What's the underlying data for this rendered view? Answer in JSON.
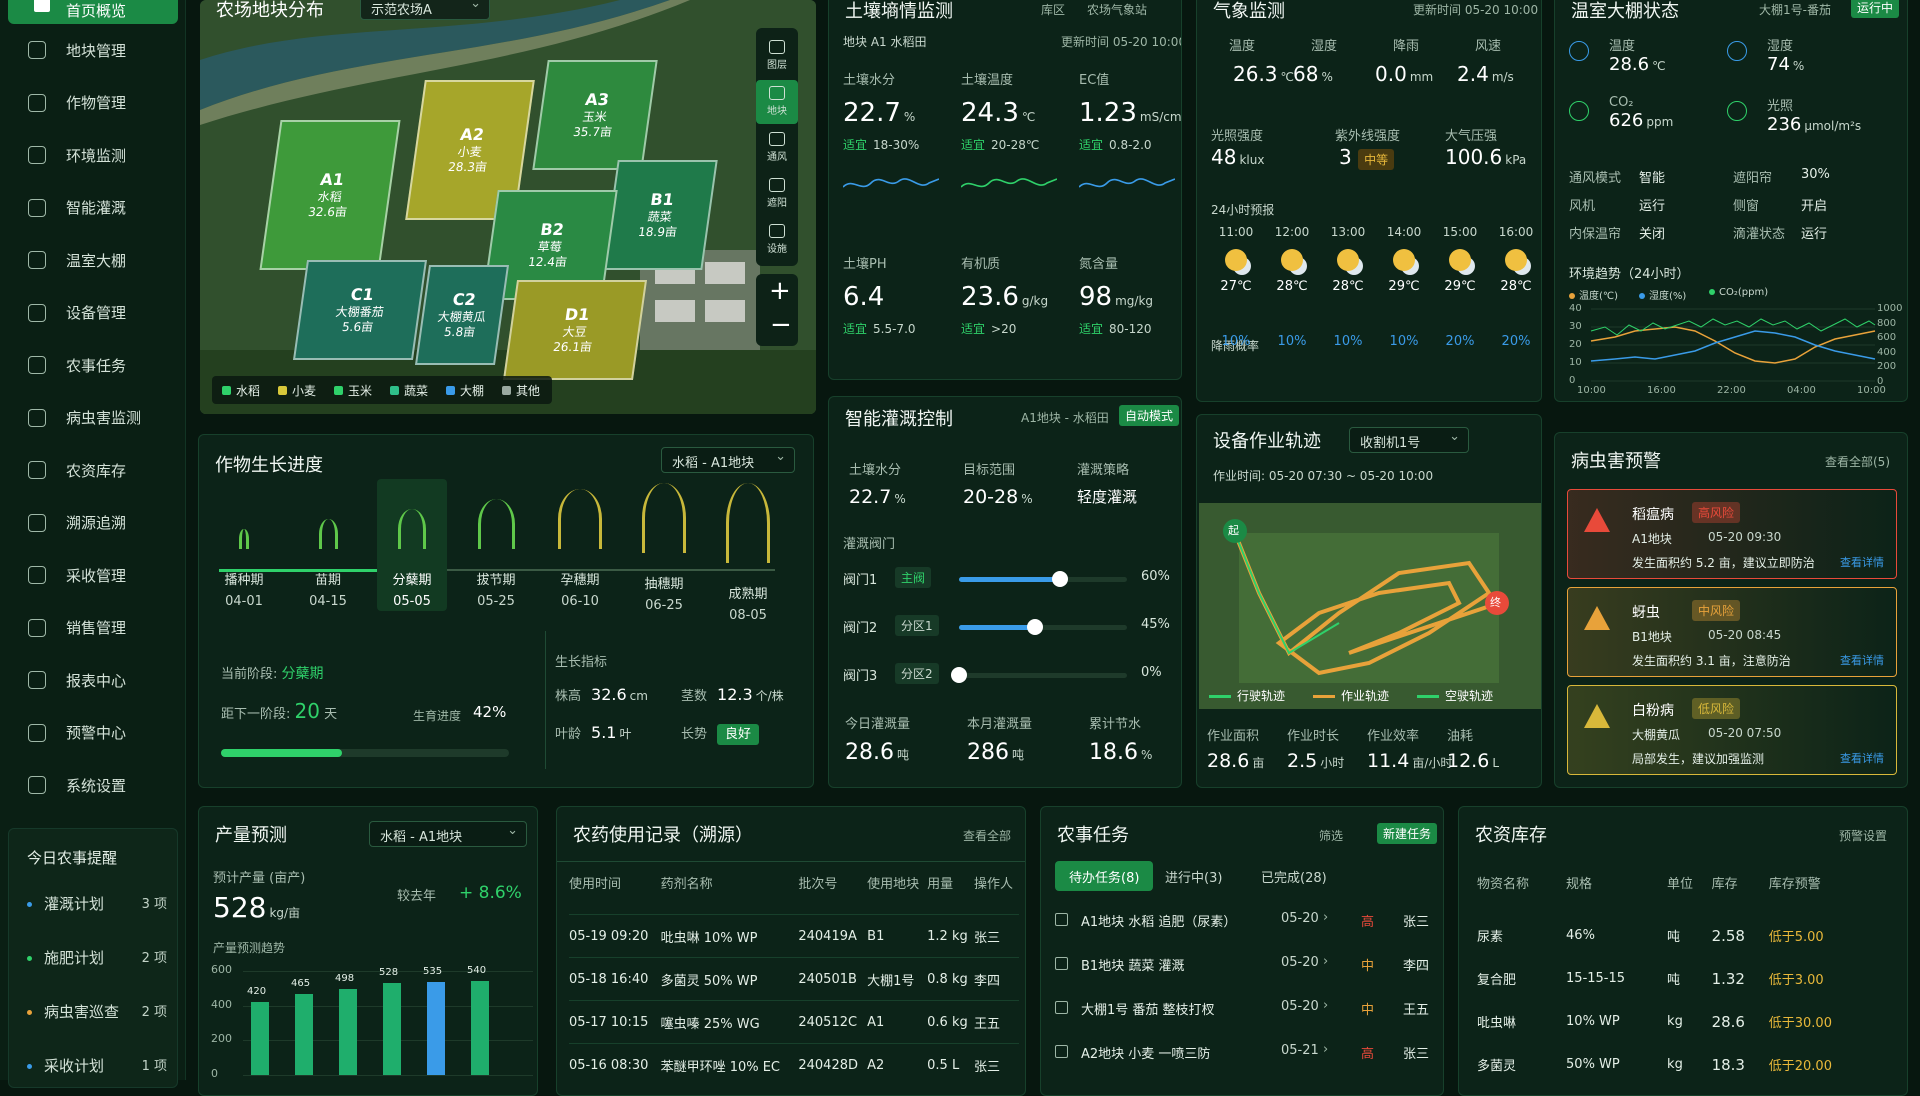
{
  "nav": {
    "top": "首页概览",
    "items": [
      "地块管理",
      "作物管理",
      "环境监测",
      "智能灌溉",
      "温室大棚",
      "设备管理",
      "农事任务",
      "病虫害监测",
      "农资库存",
      "溯源追溯",
      "采收管理",
      "销售管理",
      "报表中心",
      "预警中心",
      "系统设置"
    ]
  },
  "remind": {
    "title": "今日农事提醒",
    "items": [
      {
        "label": "灌溉计划",
        "count": "3 项",
        "color": "#3a9be8"
      },
      {
        "label": "施肥计划",
        "count": "2 项",
        "color": "#2fd16a"
      },
      {
        "label": "病虫害巡查",
        "count": "2 项",
        "color": "#e8a23a"
      },
      {
        "label": "采收计划",
        "count": "1 项",
        "color": "#3a9be8"
      }
    ]
  },
  "map": {
    "title": "农场地块分布",
    "farm": "示范农场A",
    "tools": [
      "图层",
      "地块",
      "通风",
      "遮阳",
      "设施"
    ],
    "zoom_in": "+",
    "zoom_out": "−",
    "fields": [
      {
        "id": "A1",
        "crop": "水稻",
        "area": "32.6亩",
        "color": "#3e9a3a"
      },
      {
        "id": "A2",
        "crop": "小麦",
        "area": "28.3亩",
        "color": "#a6a62a"
      },
      {
        "id": "A3",
        "crop": "玉米",
        "area": "35.7亩",
        "color": "#2e8a3e"
      },
      {
        "id": "B1",
        "crop": "蔬菜",
        "area": "18.9亩",
        "color": "#1f7a4a"
      },
      {
        "id": "B2",
        "crop": "草莓",
        "area": "12.4亩",
        "color": "#2a8a44"
      },
      {
        "id": "C1",
        "crop": "大棚番茄",
        "area": "5.6亩",
        "color": "#1e6e5a"
      },
      {
        "id": "C2",
        "crop": "大棚黄瓜",
        "area": "5.8亩",
        "color": "#1e6e5a"
      },
      {
        "id": "D1",
        "crop": "大豆",
        "area": "26.1亩",
        "color": "#9a9a26"
      }
    ],
    "legend": [
      {
        "label": "水稻",
        "color": "#2fd16a"
      },
      {
        "label": "小麦",
        "color": "#d8c83a"
      },
      {
        "label": "玉米",
        "color": "#2fd16a"
      },
      {
        "label": "蔬菜",
        "color": "#2fbf8a"
      },
      {
        "label": "大棚",
        "color": "#3a9be8"
      },
      {
        "label": "其他",
        "color": "#9aa9a0"
      }
    ]
  },
  "soil": {
    "title": "土壤墒情监测",
    "tab1": "库区",
    "tab2": "农场气象站",
    "plot": "地块 A1 水稻田",
    "updated": "更新时间 05-20 10:00",
    "metrics": [
      {
        "label": "土壤水分",
        "value": "22.7",
        "unit": "%",
        "tag": "适宜",
        "range": "18-30%"
      },
      {
        "label": "土壤温度",
        "value": "24.3",
        "unit": "℃",
        "tag": "适宜",
        "range": "20-28℃"
      },
      {
        "label": "EC值",
        "value": "1.23",
        "unit": "mS/cm",
        "tag": "适宜",
        "range": "0.8-2.0"
      },
      {
        "label": "土壤PH",
        "value": "6.4",
        "unit": "",
        "tag": "适宜",
        "range": "5.5-7.0"
      },
      {
        "label": "有机质",
        "value": "23.6",
        "unit": "g/kg",
        "tag": "适宜",
        "range": ">20"
      },
      {
        "label": "氮含量",
        "value": "98",
        "unit": "mg/kg",
        "tag": "适宜",
        "range": "80-120"
      }
    ]
  },
  "weather": {
    "title": "气象监测",
    "updated": "更新时间 05-20 10:00",
    "now": [
      {
        "label": "温度",
        "value": "26.3",
        "unit": "℃"
      },
      {
        "label": "湿度",
        "value": "68",
        "unit": "%"
      },
      {
        "label": "降雨",
        "value": "0.0",
        "unit": "mm"
      },
      {
        "label": "风速",
        "value": "2.4",
        "unit": "m/s"
      }
    ],
    "light": {
      "label": "光照强度",
      "value": "48",
      "unit": "klux"
    },
    "uv": {
      "label": "紫外线强度",
      "value": "3",
      "tag": "中等"
    },
    "pressure": {
      "label": "大气压强",
      "value": "100.6",
      "unit": "kPa"
    },
    "forecast_title": "24小时预报",
    "rain_label": "降雨概率",
    "forecast": [
      {
        "time": "11:00",
        "temp": "27℃",
        "rain": "10%"
      },
      {
        "time": "12:00",
        "temp": "28℃",
        "rain": "10%"
      },
      {
        "time": "13:00",
        "temp": "28℃",
        "rain": "10%"
      },
      {
        "time": "14:00",
        "temp": "29℃",
        "rain": "10%"
      },
      {
        "time": "15:00",
        "temp": "29℃",
        "rain": "20%"
      },
      {
        "time": "16:00",
        "temp": "28℃",
        "rain": "20%"
      }
    ]
  },
  "greenhouse": {
    "title": "温室大棚状态",
    "select": "大棚1号-番茄",
    "status": "运行中",
    "metrics": [
      {
        "label": "温度",
        "value": "28.6",
        "unit": "℃"
      },
      {
        "label": "湿度",
        "value": "74",
        "unit": "%"
      },
      {
        "label": "CO₂",
        "value": "626",
        "unit": "ppm"
      },
      {
        "label": "光照",
        "value": "236",
        "unit": "μmol/m²s"
      }
    ],
    "states": [
      [
        "通风模式",
        "智能",
        "遮阳帘",
        "30%"
      ],
      [
        "风机",
        "运行",
        "侧窗",
        "开启"
      ],
      [
        "内保温帘",
        "关闭",
        "滴灌状态",
        "运行"
      ]
    ],
    "trend_title": "环境趋势（24小时）",
    "legend": [
      "温度(℃)",
      "湿度(%)",
      "CO₂(ppm)"
    ],
    "y_left": [
      "40",
      "30",
      "20",
      "10",
      "0"
    ],
    "y_right": [
      "1000",
      "800",
      "600",
      "400",
      "200",
      "0"
    ],
    "x": [
      "10:00",
      "16:00",
      "22:00",
      "04:00",
      "10:00"
    ]
  },
  "growth": {
    "title": "作物生长进度",
    "select": "水稻 - A1地块",
    "stages": [
      {
        "name": "播种期",
        "date": "04-01"
      },
      {
        "name": "苗期",
        "date": "04-15"
      },
      {
        "name": "分蘖期",
        "date": "05-05"
      },
      {
        "name": "拔节期",
        "date": "05-25"
      },
      {
        "name": "孕穗期",
        "date": "06-10"
      },
      {
        "name": "抽穗期",
        "date": "06-25"
      },
      {
        "name": "成熟期",
        "date": "08-05"
      }
    ],
    "current_label": "当前阶段:",
    "current": "分蘖期",
    "next_label": "距下一阶段:",
    "next_days": "20",
    "next_unit": "天",
    "progress_label": "生育进度",
    "progress": "42%",
    "progress_value": 42,
    "indicator_title": "生长指标",
    "indicators": [
      {
        "label": "株高",
        "value": "32.6",
        "unit": "cm"
      },
      {
        "label": "茎数",
        "value": "12.3",
        "unit": "个/株"
      },
      {
        "label": "叶龄",
        "value": "5.1",
        "unit": "叶"
      },
      {
        "label": "长势",
        "value": "良好",
        "unit": ""
      }
    ]
  },
  "irrigation": {
    "title": "智能灌溉控制",
    "plot": "A1地块 - 水稻田",
    "mode": "自动模式",
    "top": [
      {
        "label": "土壤水分",
        "value": "22.7",
        "unit": "%"
      },
      {
        "label": "目标范围",
        "value": "20-28",
        "unit": "%"
      },
      {
        "label": "灌溉策略",
        "value": "轻度灌溉",
        "unit": ""
      }
    ],
    "valve_title": "灌溉阀门",
    "valves": [
      {
        "name": "阀门1",
        "zone": "主阀",
        "pct": "60%",
        "value": 60
      },
      {
        "name": "阀门2",
        "zone": "分区1",
        "pct": "45%",
        "value": 45
      },
      {
        "name": "阀门3",
        "zone": "分区2",
        "pct": "0%",
        "value": 0
      }
    ],
    "bottom": [
      {
        "label": "今日灌溉量",
        "value": "28.6",
        "unit": "吨"
      },
      {
        "label": "本月灌溉量",
        "value": "286",
        "unit": "吨"
      },
      {
        "label": "累计节水",
        "value": "18.6",
        "unit": "%"
      }
    ]
  },
  "track": {
    "title": "设备作业轨迹",
    "select": "收割机1号",
    "time": "作业时间: 05-20 07:30 ~ 05-20 10:00",
    "start": "起",
    "end": "终",
    "legend": [
      "行驶轨迹",
      "作业轨迹",
      "空驶轨迹"
    ],
    "stats": [
      {
        "label": "作业面积",
        "value": "28.6",
        "unit": "亩"
      },
      {
        "label": "作业时长",
        "value": "2.5",
        "unit": "小时"
      },
      {
        "label": "作业效率",
        "value": "11.4",
        "unit": "亩/小时"
      },
      {
        "label": "油耗",
        "value": "12.6",
        "unit": "L"
      }
    ]
  },
  "pest": {
    "title": "病虫害预警",
    "all": "查看全部(5)",
    "detail": "查看详情",
    "items": [
      {
        "name": "稻瘟病",
        "level": "高风险",
        "plot": "A1地块",
        "time": "05-20 09:30",
        "desc": "发生面积约 5.2 亩，建议立即防治",
        "color": "#e84a3a"
      },
      {
        "name": "蚜虫",
        "level": "中风险",
        "plot": "B1地块",
        "time": "05-20 08:45",
        "desc": "发生面积约 3.1 亩，注意防治",
        "color": "#e8a23a"
      },
      {
        "name": "白粉病",
        "level": "低风险",
        "plot": "大棚黄瓜",
        "time": "05-20 07:50",
        "desc": "局部发生，建议加强监测",
        "color": "#d8b83a"
      }
    ]
  },
  "yield": {
    "title": "产量预测",
    "select": "水稻 - A1地块",
    "est_label": "预计产量 (亩产)",
    "est_value": "528",
    "est_unit": "kg/亩",
    "cmp_label": "较去年",
    "cmp_value": "+ 8.6%",
    "trend_label": "产量预测趋势"
  },
  "chart_data": {
    "type": "bar",
    "title": "产量预测趋势",
    "y_ticks": [
      "600",
      "400",
      "200",
      "0"
    ],
    "ylim": [
      0,
      600
    ],
    "values": [
      420,
      465,
      498,
      528,
      535,
      540
    ],
    "labels": [
      "420",
      "465",
      "498",
      "528",
      "535",
      "540"
    ],
    "colors": [
      "#1fae6c",
      "#1fae6c",
      "#1fae6c",
      "#1fae6c",
      "#3a9be8",
      "#1fae6c"
    ]
  },
  "pesticide": {
    "title": "农药使用记录（溯源）",
    "all": "查看全部",
    "headers": [
      "使用时间",
      "药剂名称",
      "批次号",
      "使用地块",
      "用量",
      "操作人"
    ],
    "rows": [
      [
        "05-19 09:20",
        "吡虫啉 10% WP",
        "240419A",
        "B1",
        "1.2 kg",
        "张三"
      ],
      [
        "05-18 16:40",
        "多菌灵 50% WP",
        "240501B",
        "大棚1号",
        "0.8 kg",
        "李四"
      ],
      [
        "05-17 10:15",
        "噻虫嗪 25% WG",
        "240512C",
        "A1",
        "0.6 kg",
        "王五"
      ],
      [
        "05-16 08:30",
        "苯醚甲环唑 10% EC",
        "240428D",
        "A2",
        "0.5 L",
        "张三"
      ]
    ]
  },
  "tasks": {
    "title": "农事任务",
    "filter": "筛选",
    "new": "新建任务",
    "tabs": [
      "待办任务(8)",
      "进行中(3)",
      "已完成(28)"
    ],
    "rows": [
      {
        "text": "A1地块 水稻 追肥（尿素）",
        "date": "05-20",
        "pri": "高",
        "who": "张三",
        "color": "#e84a3a"
      },
      {
        "text": "B1地块 蔬菜 灌溉",
        "date": "05-20",
        "pri": "中",
        "who": "李四",
        "color": "#e8a23a"
      },
      {
        "text": "大棚1号 番茄 整枝打杈",
        "date": "05-20",
        "pri": "中",
        "who": "王五",
        "color": "#e8a23a"
      },
      {
        "text": "A2地块 小麦 一喷三防",
        "date": "05-21",
        "pri": "高",
        "who": "张三",
        "color": "#e84a3a"
      }
    ]
  },
  "inventory": {
    "title": "农资库存",
    "setting": "预警设置",
    "headers": [
      "物资名称",
      "规格",
      "单位",
      "库存",
      "库存预警"
    ],
    "rows": [
      [
        "尿素",
        "46%",
        "吨",
        "2.58",
        "低于5.00"
      ],
      [
        "复合肥",
        "15-15-15",
        "吨",
        "1.32",
        "低于3.00"
      ],
      [
        "吡虫啉",
        "10% WP",
        "kg",
        "28.6",
        "低于30.00"
      ],
      [
        "多菌灵",
        "50% WP",
        "kg",
        "18.3",
        "低于20.00"
      ]
    ]
  }
}
